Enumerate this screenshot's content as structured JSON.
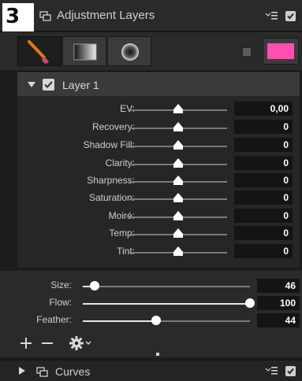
{
  "badge": "3",
  "header": {
    "title": "Adjustment Layers"
  },
  "tools": {
    "items": [
      {
        "name": "brush-tool-button",
        "icon": "brush-icon"
      },
      {
        "name": "gradient-tool-button",
        "icon": "gradient-icon"
      },
      {
        "name": "radial-tool-button",
        "icon": "radial-icon"
      }
    ],
    "mask_color": "#ff4fb0"
  },
  "layer": {
    "name": "Layer 1",
    "checked": true,
    "expanded": true
  },
  "adjustments": [
    {
      "label": "EV:",
      "value": "0,00",
      "slider": 0.5
    },
    {
      "label": "Recovery:",
      "value": "0",
      "slider": 0.5
    },
    {
      "label": "Shadow Fill:",
      "value": "0",
      "slider": 0.5
    },
    {
      "label": "Clarity:",
      "value": "0",
      "slider": 0.5
    },
    {
      "label": "Sharpness:",
      "value": "0",
      "slider": 0.5
    },
    {
      "label": "Saturation:",
      "value": "0",
      "slider": 0.5
    },
    {
      "label": "Moiré:",
      "value": "0",
      "slider": 0.5
    },
    {
      "label": "Temp:",
      "value": "0",
      "slider": 0.5
    },
    {
      "label": "Tint:",
      "value": "0",
      "slider": 0.5
    }
  ],
  "brush": [
    {
      "label": "Size:",
      "value": "46",
      "fill": 0.07
    },
    {
      "label": "Flow:",
      "value": "100",
      "fill": 1.0
    },
    {
      "label": "Feather:",
      "value": "44",
      "fill": 0.44
    }
  ],
  "bottom_tools": {
    "add": "+",
    "remove": "—",
    "settings_icon": "gear-icon"
  },
  "footer": {
    "title": "Curves",
    "expanded": false,
    "checked": true
  }
}
